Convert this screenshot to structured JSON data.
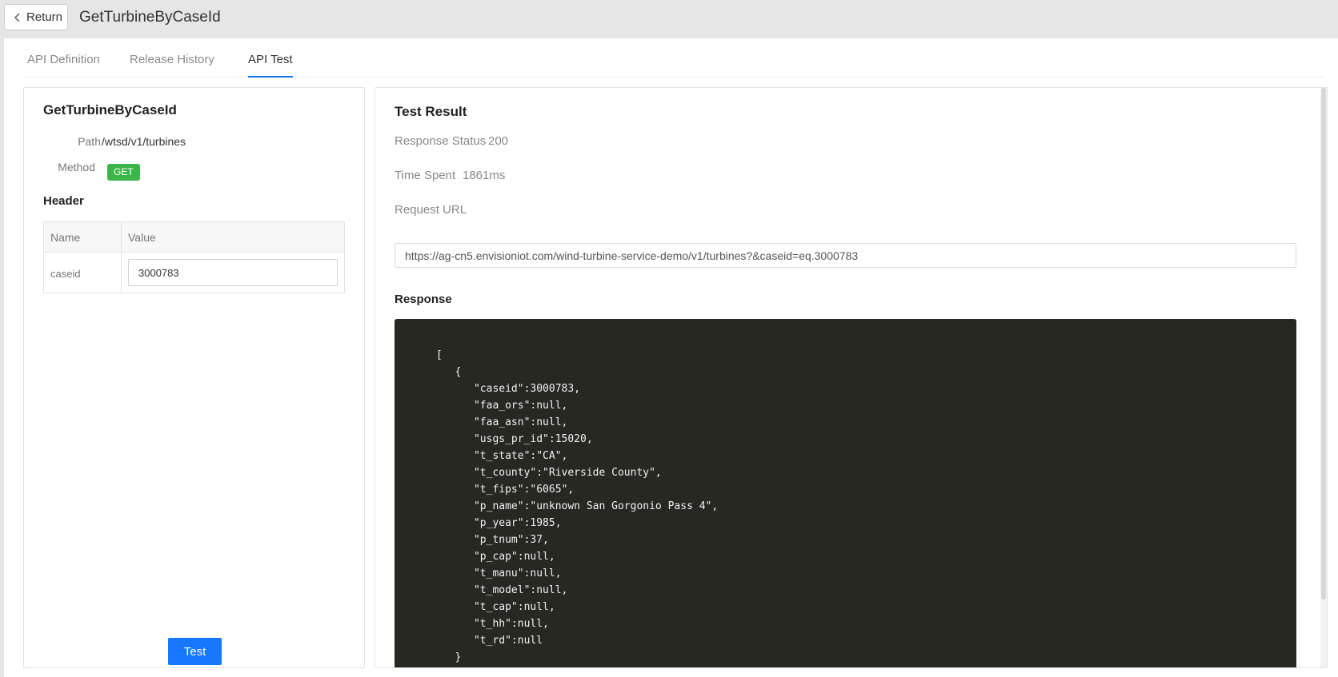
{
  "header": {
    "return_label": "Return",
    "title": "GetTurbineByCaseId"
  },
  "tabs": [
    {
      "label": "API Definition",
      "active": false
    },
    {
      "label": "Release History",
      "active": false
    },
    {
      "label": "API Test",
      "active": true
    }
  ],
  "left": {
    "title": "GetTurbineByCaseId",
    "path_label": "Path",
    "path_value": "/wtsd/v1/turbines",
    "method_label": "Method",
    "method_value": "GET",
    "header_section": "Header",
    "table": {
      "col_name": "Name",
      "col_value": "Value",
      "rows": [
        {
          "name": "caseid",
          "value": "3000783"
        }
      ]
    },
    "test_button": "Test"
  },
  "right": {
    "title": "Test Result",
    "status_label": "Response Status",
    "status_value": "200",
    "time_label": "Time Spent",
    "time_value": "1861ms",
    "url_label": "Request URL",
    "url_value": "https://ag-cn5.envisioniot.com/wind-turbine-service-demo/v1/turbines?&caseid=eq.3000783",
    "response_label": "Response",
    "response_body": "[\n   {\n      \"caseid\":3000783,\n      \"faa_ors\":null,\n      \"faa_asn\":null,\n      \"usgs_pr_id\":15020,\n      \"t_state\":\"CA\",\n      \"t_county\":\"Riverside County\",\n      \"t_fips\":\"6065\",\n      \"p_name\":\"unknown San Gorgonio Pass 4\",\n      \"p_year\":1985,\n      \"p_tnum\":37,\n      \"p_cap\":null,\n      \"t_manu\":null,\n      \"t_model\":null,\n      \"t_cap\":null,\n      \"t_hh\":null,\n      \"t_rd\":null\n   }"
  },
  "colors": {
    "accent": "#1677ff",
    "method_badge": "#3bb54a",
    "code_bg": "#272822"
  }
}
